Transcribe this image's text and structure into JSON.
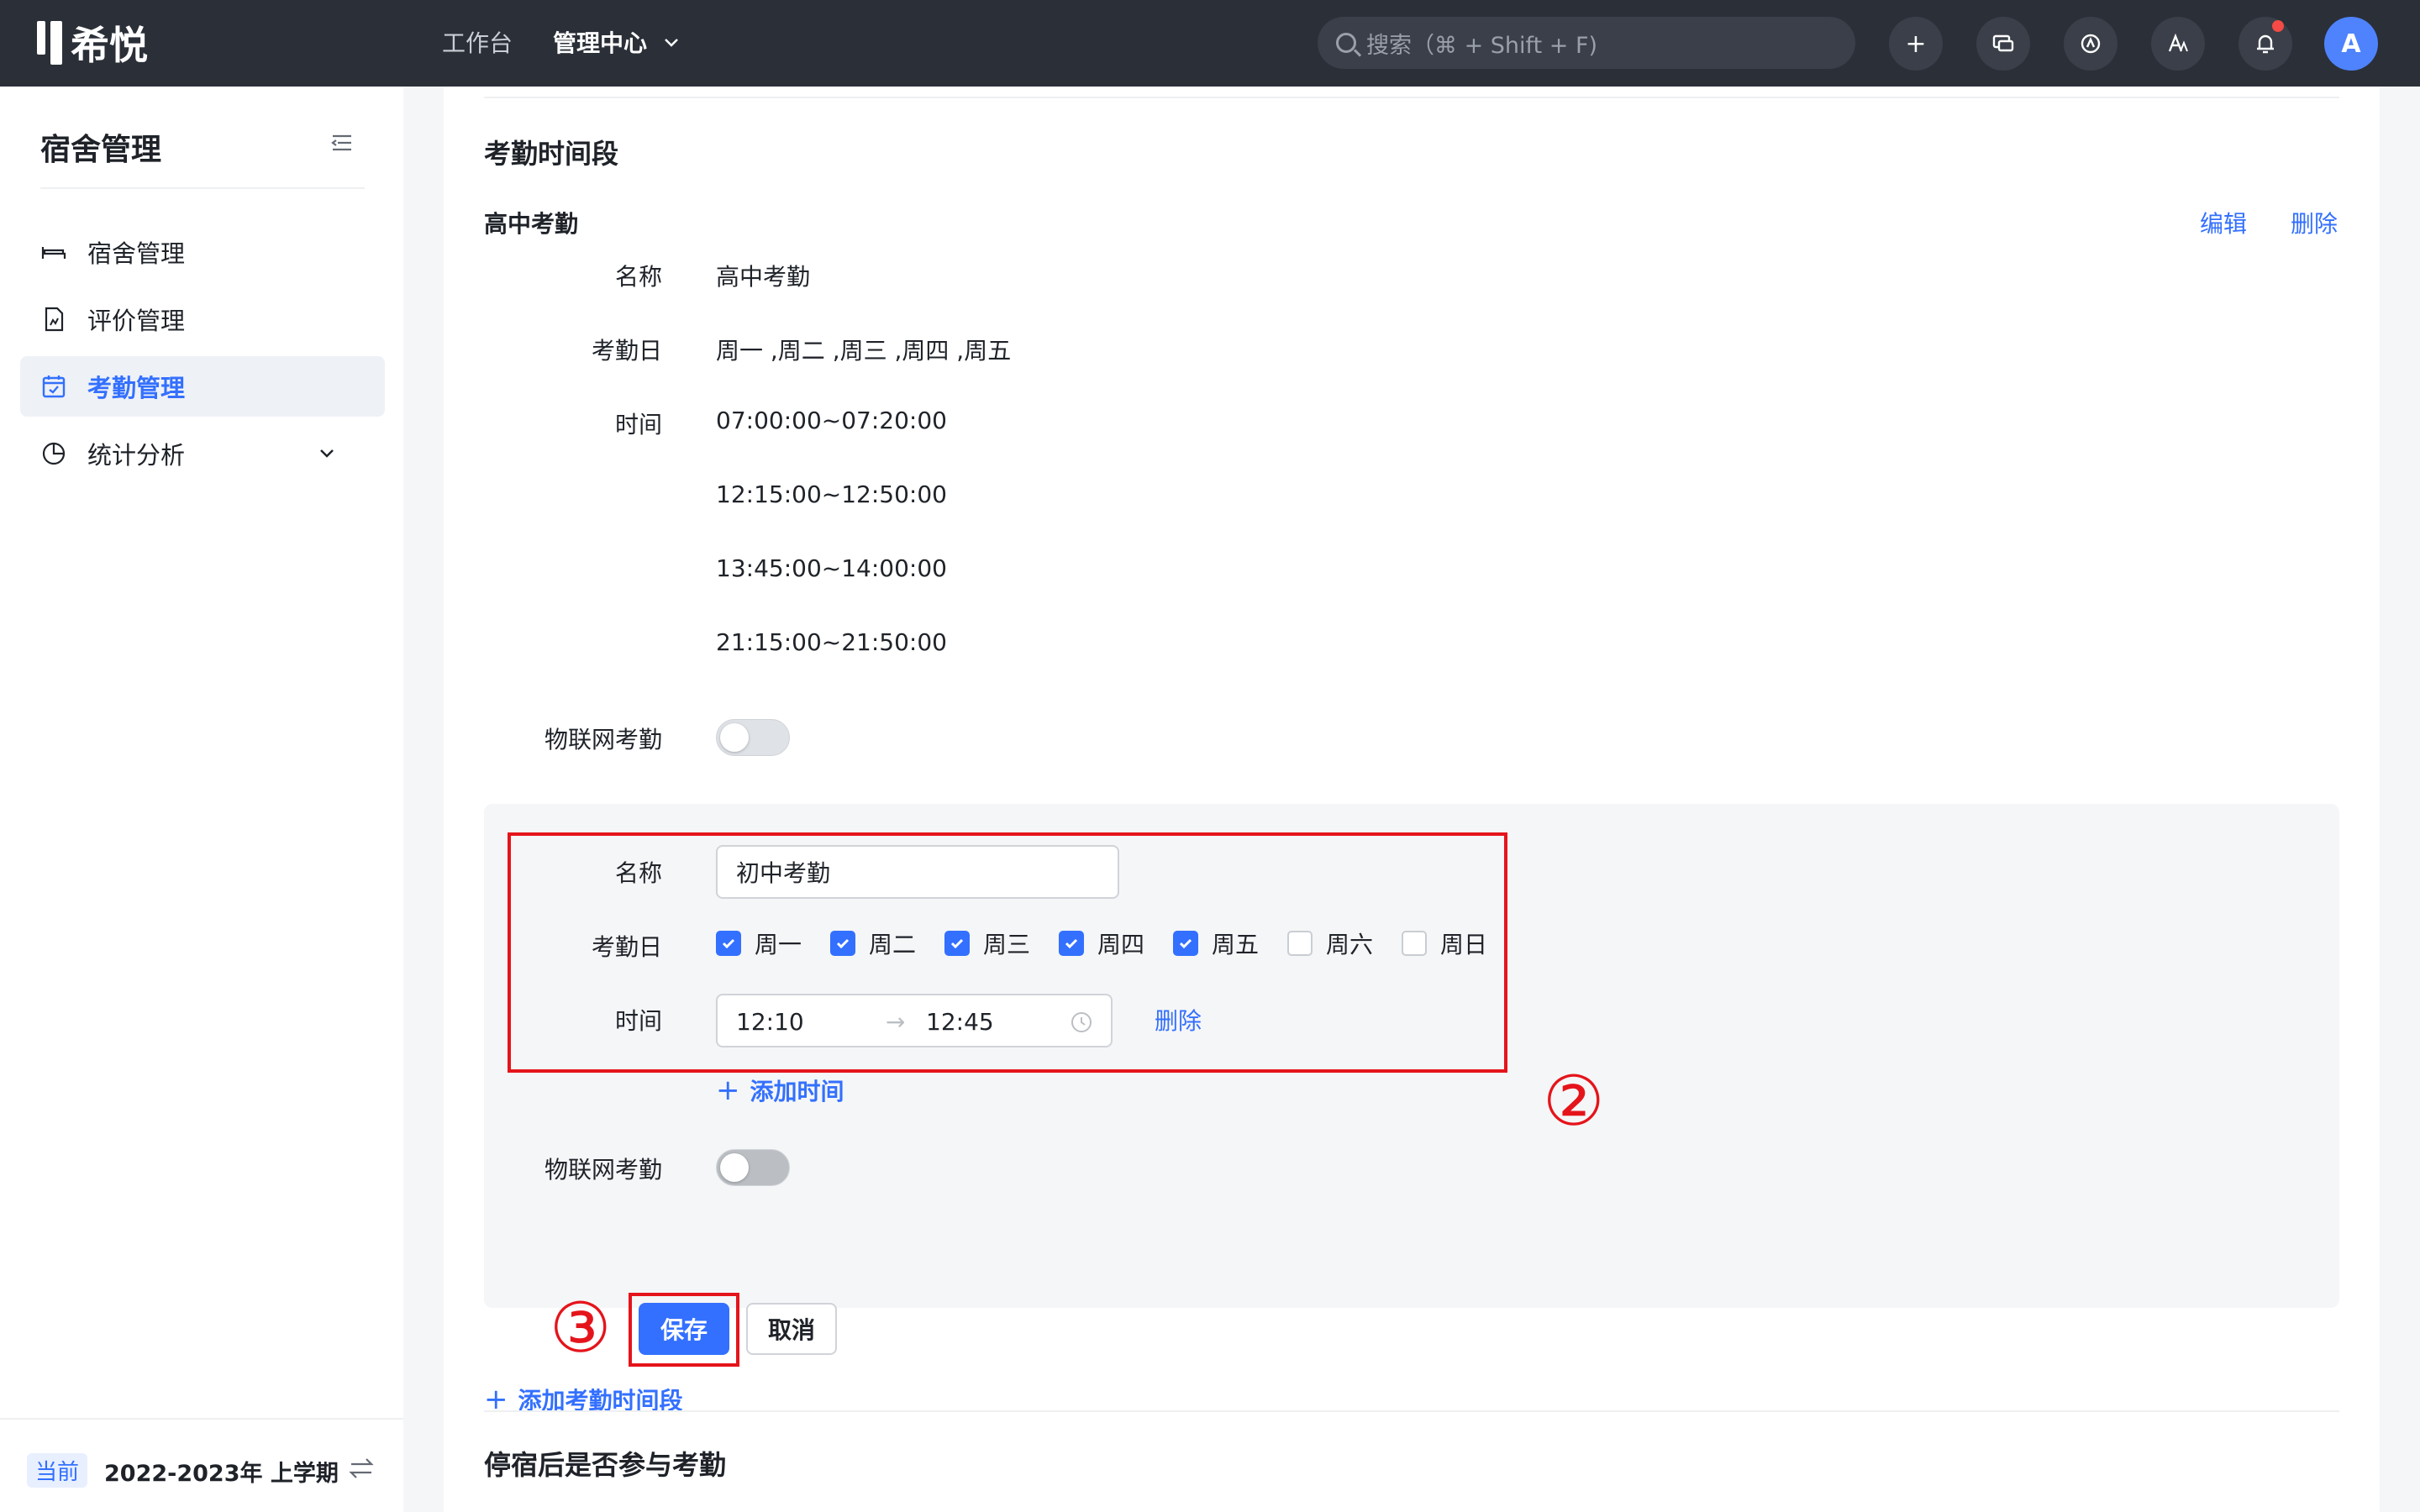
{
  "app": {
    "name": "希悦"
  },
  "topnav": {
    "workbench": "工作台",
    "admin_center": "管理中心",
    "search_placeholder": "搜索（⌘ + Shift + F)",
    "avatar_letter": "A"
  },
  "sidebar": {
    "title": "宿舍管理",
    "items": [
      {
        "label": "宿舍管理",
        "icon": "bed-icon"
      },
      {
        "label": "评价管理",
        "icon": "document-chart-icon"
      },
      {
        "label": "考勤管理",
        "icon": "calendar-check-icon",
        "active": true
      },
      {
        "label": "统计分析",
        "icon": "pie-chart-icon",
        "expandable": true
      }
    ],
    "footer": {
      "badge": "当前",
      "term": "2022-2023年 上学期"
    }
  },
  "main": {
    "section_title": "考勤时间段",
    "group1": {
      "title": "高中考勤",
      "edit": "编辑",
      "delete": "删除",
      "name_label": "名称",
      "name_value": "高中考勤",
      "days_label": "考勤日",
      "days_value": "周一 ,周二 ,周三 ,周四 ,周五",
      "time_label": "时间",
      "times": [
        "07:00:00~07:20:00",
        "12:15:00~12:50:00",
        "13:45:00~14:00:00",
        "21:15:00~21:50:00"
      ],
      "iot_label": "物联网考勤"
    },
    "edit_form": {
      "name_label": "名称",
      "name_value": "初中考勤",
      "days_label": "考勤日",
      "days": [
        {
          "label": "周一",
          "checked": true
        },
        {
          "label": "周二",
          "checked": true
        },
        {
          "label": "周三",
          "checked": true
        },
        {
          "label": "周四",
          "checked": true
        },
        {
          "label": "周五",
          "checked": true
        },
        {
          "label": "周六",
          "checked": false
        },
        {
          "label": "周日",
          "checked": false
        }
      ],
      "time_label": "时间",
      "time_start": "12:10",
      "time_end": "12:45",
      "delete": "删除",
      "add_time": "添加时间",
      "iot_label": "物联网考勤",
      "save": "保存",
      "cancel": "取消"
    },
    "annotations": {
      "step2": "②",
      "step3": "③"
    },
    "add_period": "添加考勤时间段",
    "section2_title": "停宿后是否参与考勤"
  },
  "colors": {
    "accent": "#3370ff",
    "topbar": "#2b2f38",
    "annotation_red": "#e5141b"
  }
}
